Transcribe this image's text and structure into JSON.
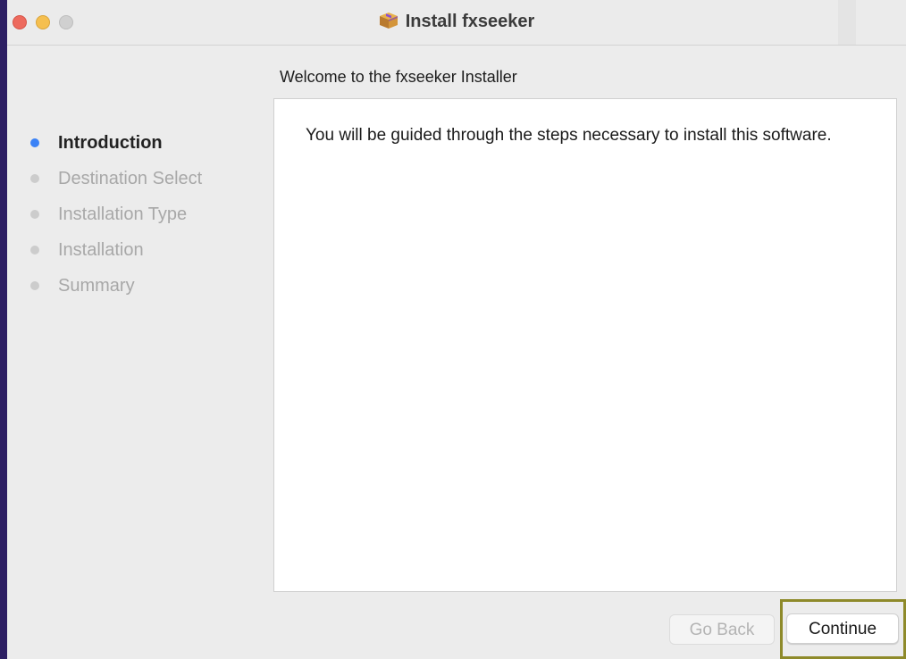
{
  "window": {
    "title": "Install fxseeker",
    "title_icon": "package-icon"
  },
  "header": {
    "subtitle": "Welcome to the fxseeker Installer"
  },
  "steps": [
    {
      "label": "Introduction",
      "active": true
    },
    {
      "label": "Destination Select",
      "active": false
    },
    {
      "label": "Installation Type",
      "active": false
    },
    {
      "label": "Installation",
      "active": false
    },
    {
      "label": "Summary",
      "active": false
    }
  ],
  "content": {
    "text": "You will be guided through the steps necessary to install this software."
  },
  "buttons": {
    "back_label": "Go Back",
    "continue_label": "Continue"
  },
  "colors": {
    "active_step": "#3b82f6",
    "inactive_step": "#cccccc",
    "close": "#ed6a5e",
    "minimize": "#f5bf4f",
    "zoom_disabled": "#d0d0d0",
    "highlight_border": "#8e8a2a"
  }
}
